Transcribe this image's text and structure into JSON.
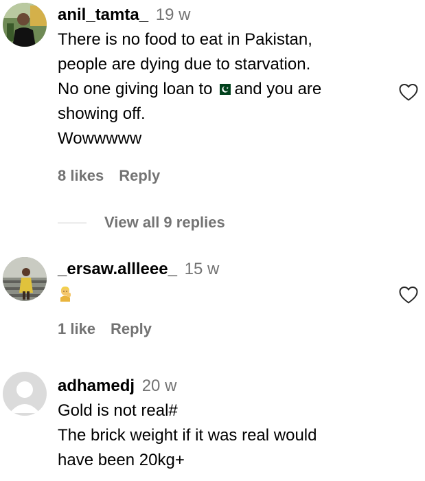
{
  "comments": [
    {
      "username": "anil_tamta_",
      "time": "19 w",
      "lines": [
        "There is no food to eat in Pakistan,",
        "people are dying due to starvation."
      ],
      "line3_before_flag": "No one giving loan to",
      "flag_icon": "pakistan-flag-emoji",
      "line3_after_flag": "and you are",
      "line4": "showing off.",
      "line5": "Wowwwww",
      "likes": "8 likes",
      "reply": "Reply",
      "view_replies": "View all 9 replies"
    },
    {
      "username": "_ersaw.allleee_",
      "time": "15 w",
      "emoji_icon": "person-gesturing-emoji",
      "likes": "1 like",
      "reply": "Reply"
    },
    {
      "username": "adhamedj",
      "time": "20 w",
      "lines": [
        "Gold is not real#",
        "The brick weight if it was real would",
        "have been 20kg+"
      ]
    }
  ],
  "icons": {
    "like": "heart-outline-icon"
  },
  "colors": {
    "text": "#000000",
    "secondary": "#737373",
    "divider": "#c7c7c7",
    "flag_green": "#01411c"
  }
}
